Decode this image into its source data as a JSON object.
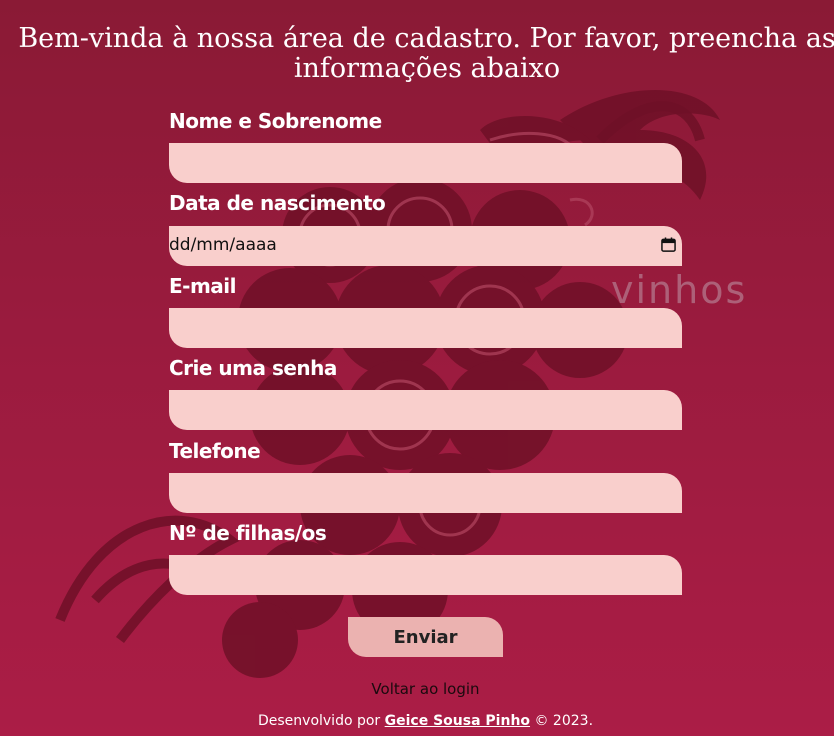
{
  "page": {
    "title": "Bem-vinda à nossa área de cadastro. Por favor, preencha as informações abaixo"
  },
  "background": {
    "logo_word": "vinhos"
  },
  "form": {
    "fields": [
      {
        "label": "Nome e Sobrenome",
        "value": "",
        "placeholder": ""
      },
      {
        "label": "Data de nascimento",
        "value": "",
        "placeholder": "dd/mm/aaaa"
      },
      {
        "label": "E-mail",
        "value": "",
        "placeholder": ""
      },
      {
        "label": "Crie uma senha",
        "value": "",
        "placeholder": ""
      },
      {
        "label": "Telefone",
        "value": "",
        "placeholder": ""
      },
      {
        "label": "Nº de filhas/os",
        "value": "",
        "placeholder": ""
      }
    ],
    "submit_label": "Enviar"
  },
  "links": {
    "back_to_login": "Voltar ao login"
  },
  "footer": {
    "prefix": "Desenvolvido por",
    "author": "Geice Sousa Pinho",
    "suffix": "© 2023."
  },
  "colors": {
    "background_top": "#8a1a35",
    "background_bottom": "#ab1d46",
    "input_fill": "#f9cfcc",
    "button_fill": "#ebb2b0",
    "text": "#ffffff"
  },
  "icons": {
    "date_picker": "calendar-icon"
  }
}
